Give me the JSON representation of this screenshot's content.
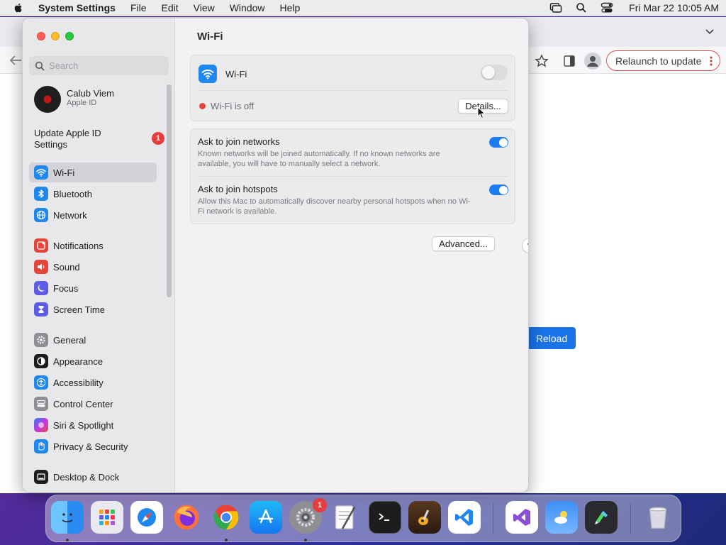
{
  "menubar": {
    "app_name": "System Settings",
    "menus": [
      "File",
      "Edit",
      "View",
      "Window",
      "Help"
    ],
    "clock": "Fri Mar 22  10:05 AM",
    "status_icons": [
      "screen-mirroring-icon",
      "spotlight-search-icon",
      "control-center-icon"
    ]
  },
  "browser": {
    "relaunch_label": "Relaunch to update",
    "reload_label": "Reload"
  },
  "settings": {
    "search_placeholder": "Search",
    "account": {
      "name": "Calub Viem",
      "subtitle": "Apple ID"
    },
    "update": {
      "label": "Update Apple ID Settings",
      "badge": "1"
    },
    "sidebar": {
      "items": [
        {
          "label": "Wi-Fi",
          "icon": "wifi-icon",
          "color": "#1e88f0",
          "selected": true
        },
        {
          "label": "Bluetooth",
          "icon": "bluetooth-icon",
          "color": "#1e88f0"
        },
        {
          "label": "Network",
          "icon": "globe-icon",
          "color": "#1e88f0"
        },
        {
          "label": "Notifications",
          "icon": "bell-icon",
          "color": "#e5453a"
        },
        {
          "label": "Sound",
          "icon": "speaker-icon",
          "color": "#e5453a"
        },
        {
          "label": "Focus",
          "icon": "moon-icon",
          "color": "#5e5ce6"
        },
        {
          "label": "Screen Time",
          "icon": "hourglass-icon",
          "color": "#5e5ce6"
        },
        {
          "label": "General",
          "icon": "gear-icon",
          "color": "#8e8e93"
        },
        {
          "label": "Appearance",
          "icon": "appearance-icon",
          "color": "#1d1d1f"
        },
        {
          "label": "Accessibility",
          "icon": "accessibility-icon",
          "color": "#1e88f0"
        },
        {
          "label": "Control Center",
          "icon": "control-center-icon",
          "color": "#8e8e93"
        },
        {
          "label": "Siri & Spotlight",
          "icon": "siri-icon",
          "color": "#7b3fe4"
        },
        {
          "label": "Privacy & Security",
          "icon": "hand-icon",
          "color": "#1e88f0"
        },
        {
          "label": "Desktop & Dock",
          "icon": "dock-icon",
          "color": "#1d1d1f"
        }
      ]
    },
    "content": {
      "title": "Wi-Fi",
      "wifi_label": "Wi-Fi",
      "wifi_enabled": false,
      "status": "Wi-Fi is off",
      "details_button": "Details...",
      "options": [
        {
          "title": "Ask to join networks",
          "description": "Known networks will be joined automatically. If no known networks are available, you will have to manually select a network.",
          "enabled": true
        },
        {
          "title": "Ask to join hotspots",
          "description": "Allow this Mac to automatically discover nearby personal hotspots when no Wi-Fi network is available.",
          "enabled": true
        }
      ],
      "advanced_button": "Advanced...",
      "help_button": "?"
    }
  },
  "dock": {
    "apps": [
      {
        "name": "Finder",
        "icon": "finder-icon",
        "running": true
      },
      {
        "name": "Launchpad",
        "icon": "launchpad-icon"
      },
      {
        "name": "Safari",
        "icon": "safari-icon"
      },
      {
        "name": "Firefox",
        "icon": "firefox-icon"
      },
      {
        "name": "Chrome",
        "icon": "chrome-icon",
        "running": true
      },
      {
        "name": "App Store",
        "icon": "app-store-icon"
      },
      {
        "name": "System Settings",
        "icon": "system-settings-icon",
        "running": true,
        "badge": "1"
      },
      {
        "name": "TextEdit",
        "icon": "textedit-icon"
      },
      {
        "name": "Terminal",
        "icon": "terminal-icon"
      },
      {
        "name": "GarageBand",
        "icon": "garageband-icon"
      },
      {
        "name": "Visual Studio Code",
        "icon": "vscode-icon"
      },
      {
        "name": "Visual Studio",
        "icon": "visual-studio-icon"
      },
      {
        "name": "Weather",
        "icon": "weather-icon"
      },
      {
        "name": "Script Editor",
        "icon": "script-icon"
      },
      {
        "name": "Trash",
        "icon": "trash-icon"
      }
    ]
  }
}
